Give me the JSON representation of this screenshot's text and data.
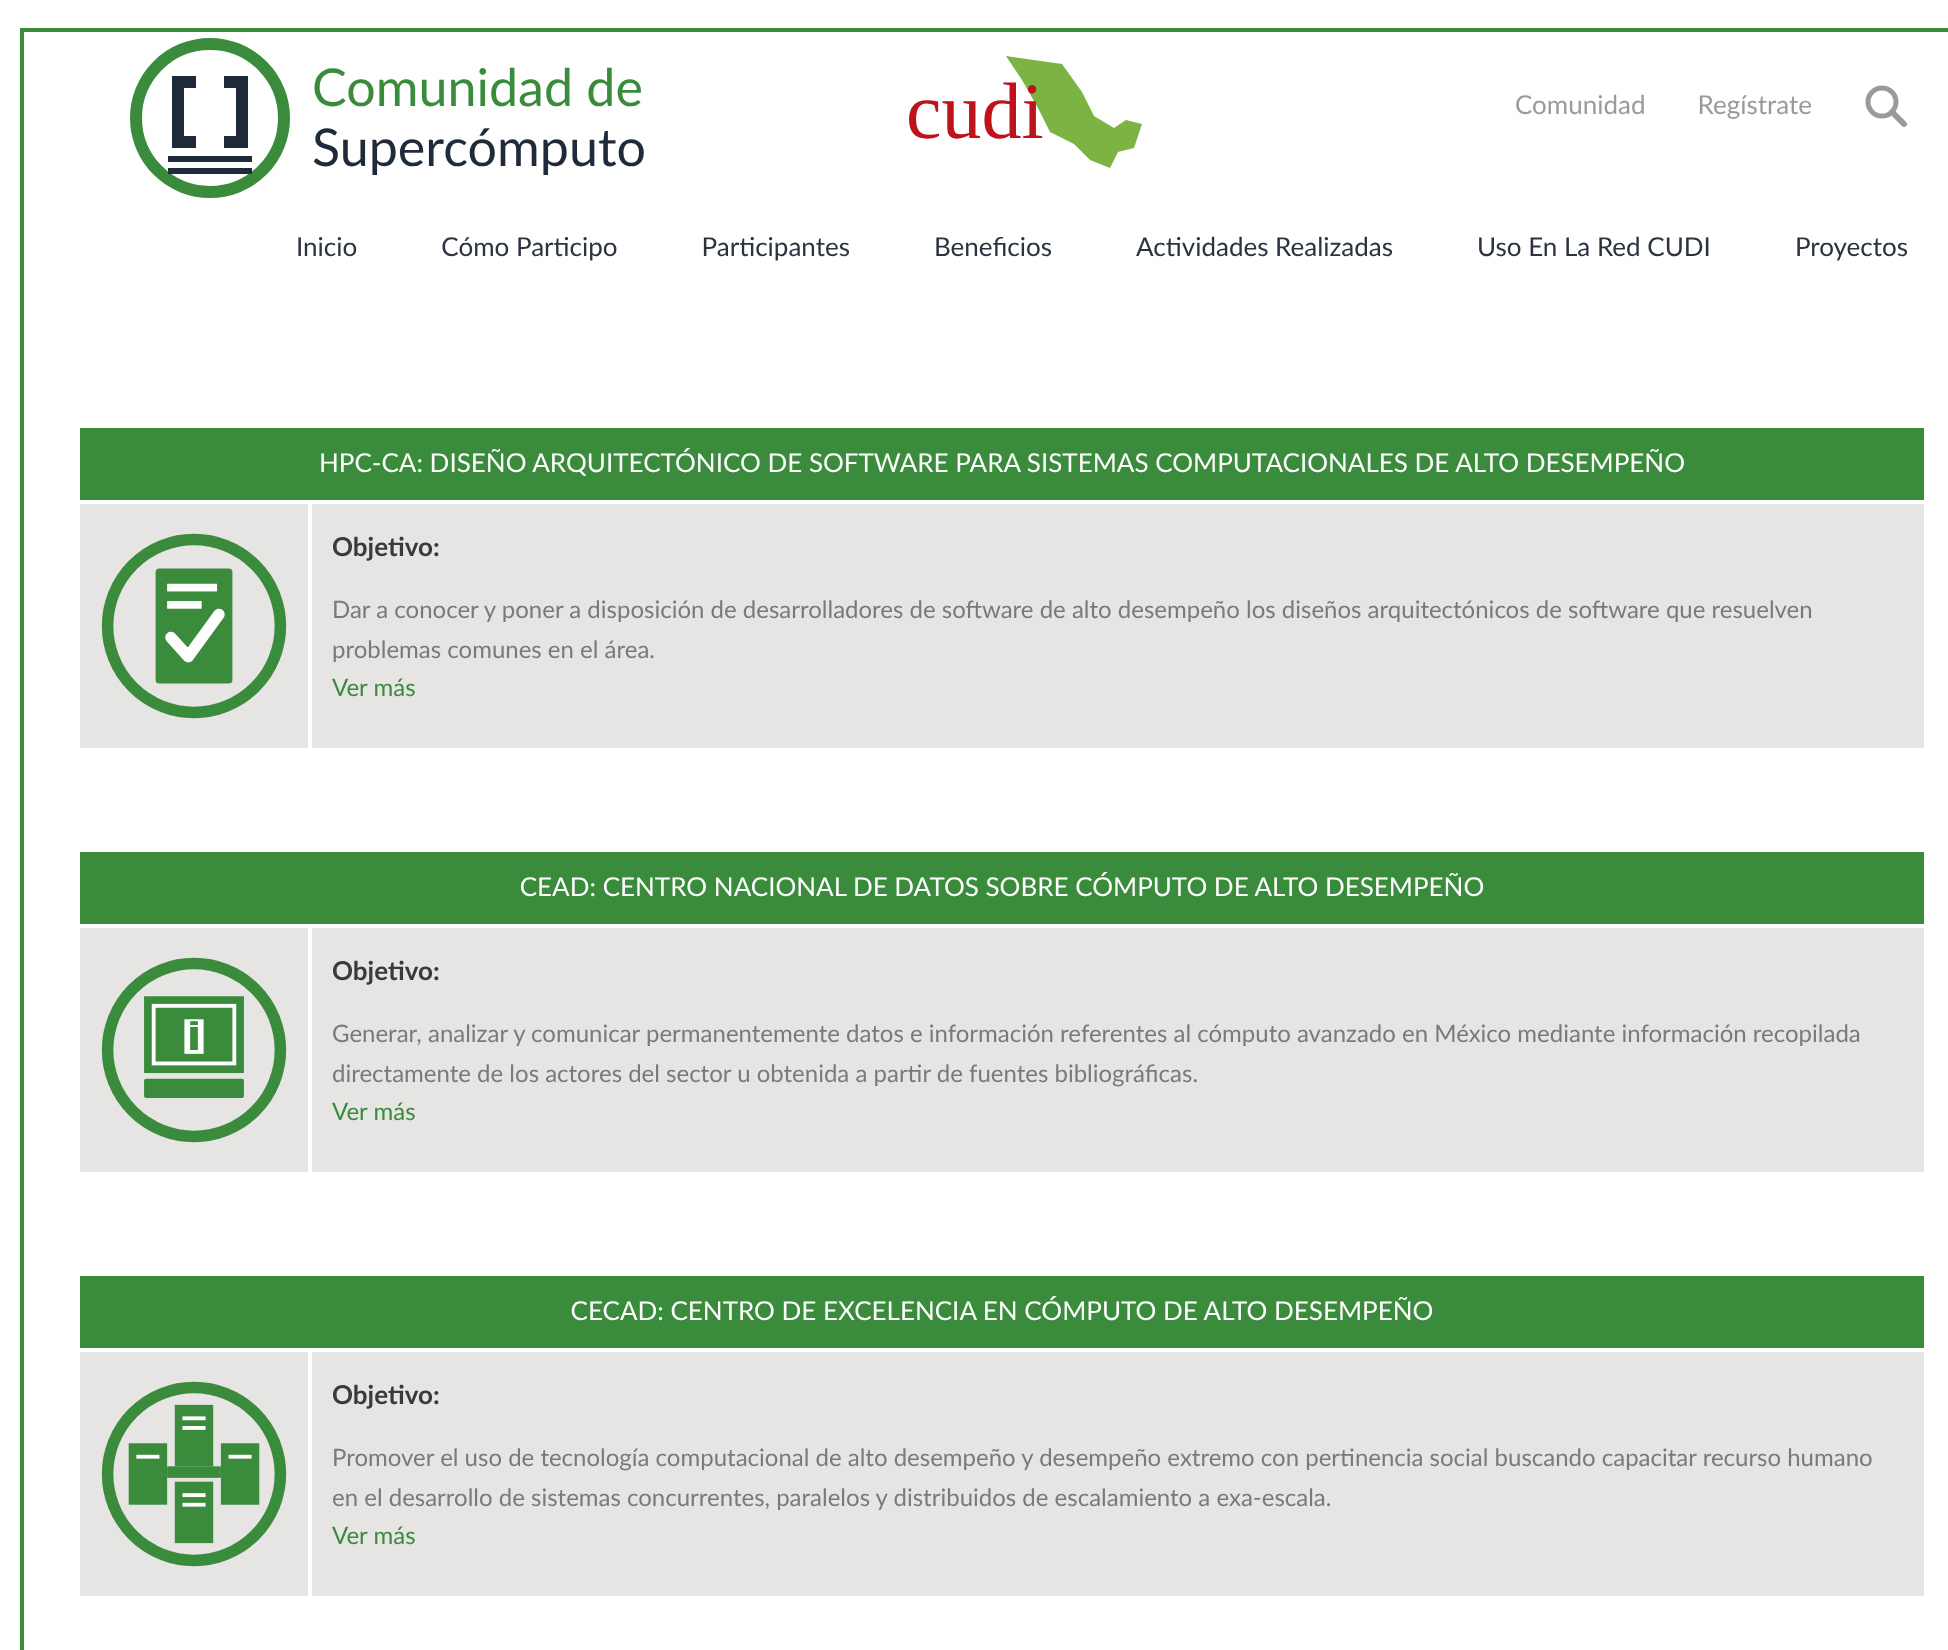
{
  "brand": {
    "line1": "Comunidad de",
    "line2": "Supercómputo",
    "partner": "cudi"
  },
  "top_links": [
    "Comunidad",
    "Regístrate"
  ],
  "nav": [
    "Inicio",
    "Cómo Participo",
    "Participantes",
    "Beneficios",
    "Actividades Realizadas",
    "Uso En La Red CUDI",
    "Proyectos"
  ],
  "projects": [
    {
      "kind": "document-check",
      "title": "HPC-CA: DISEÑO ARQUITECTÓNICO DE SOFTWARE PARA SISTEMAS COMPUTACIONALES DE ALTO DESEMPEÑO",
      "label": "Objetivo:",
      "text": "Dar a conocer y poner a disposición de desarrolladores de software de alto desempeño los diseños arquitectónicos de software que resuelven problemas comunes en el área.",
      "link": "Ver más"
    },
    {
      "kind": "monitor-info",
      "title": "CEAD: CENTRO NACIONAL DE DATOS SOBRE CÓMPUTO DE ALTO DESEMPEÑO",
      "label": "Objetivo:",
      "text": "Generar, analizar y comunicar permanentemente datos e información referentes al cómputo avanzado en México mediante información recopilada directamente de los actores del sector u obtenida a partir de fuentes bibliográficas.",
      "link": "Ver más"
    },
    {
      "kind": "servers",
      "title": "CECAD: CENTRO DE EXCELENCIA EN CÓMPUTO DE ALTO DESEMPEÑO",
      "label": "Objetivo:",
      "text": "Promover el uso de tecnología computacional de alto desempeño y desempeño extremo con pertinencia social buscando capacitar recurso humano en el desarrollo de sistemas concurrentes, paralelos y distribuidos de escalamiento a exa-escala.",
      "link": "Ver más"
    }
  ]
}
